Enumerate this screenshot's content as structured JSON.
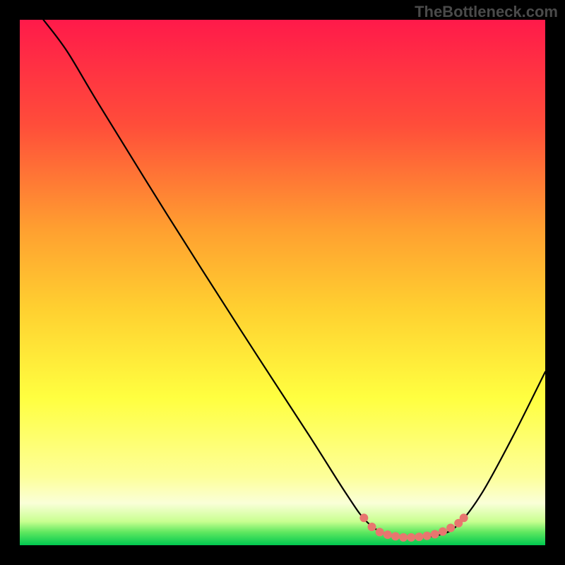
{
  "watermark": "TheBottleneck.com",
  "chart_data": {
    "type": "line",
    "title": "",
    "xlabel": "",
    "ylabel": "",
    "xlim": [
      0,
      100
    ],
    "ylim": [
      0,
      100
    ],
    "gradient_stops": [
      {
        "offset": 0,
        "color": "#ff1a4a"
      },
      {
        "offset": 20,
        "color": "#ff4d3a"
      },
      {
        "offset": 40,
        "color": "#ffa030"
      },
      {
        "offset": 55,
        "color": "#ffd030"
      },
      {
        "offset": 72,
        "color": "#ffff40"
      },
      {
        "offset": 87,
        "color": "#fdff9a"
      },
      {
        "offset": 92,
        "color": "#faffd8"
      },
      {
        "offset": 95.5,
        "color": "#c8ff90"
      },
      {
        "offset": 97.5,
        "color": "#60e860"
      },
      {
        "offset": 100,
        "color": "#00c850"
      }
    ],
    "curve_points": [
      {
        "x": 4.5,
        "y": 100
      },
      {
        "x": 9,
        "y": 94
      },
      {
        "x": 15,
        "y": 84
      },
      {
        "x": 28,
        "y": 63
      },
      {
        "x": 42,
        "y": 41
      },
      {
        "x": 55,
        "y": 21
      },
      {
        "x": 62,
        "y": 10
      },
      {
        "x": 66,
        "y": 4.5
      },
      {
        "x": 70,
        "y": 2
      },
      {
        "x": 75,
        "y": 1.5
      },
      {
        "x": 80,
        "y": 2
      },
      {
        "x": 83.5,
        "y": 4
      },
      {
        "x": 88,
        "y": 10
      },
      {
        "x": 94,
        "y": 21
      },
      {
        "x": 100,
        "y": 33
      }
    ],
    "highlight_dots": [
      {
        "x": 65.5,
        "y": 5.2
      },
      {
        "x": 67,
        "y": 3.5
      },
      {
        "x": 68.5,
        "y": 2.5
      },
      {
        "x": 70,
        "y": 2.0
      },
      {
        "x": 71.5,
        "y": 1.7
      },
      {
        "x": 73,
        "y": 1.5
      },
      {
        "x": 74.5,
        "y": 1.5
      },
      {
        "x": 76,
        "y": 1.6
      },
      {
        "x": 77.5,
        "y": 1.8
      },
      {
        "x": 79,
        "y": 2.1
      },
      {
        "x": 80.5,
        "y": 2.6
      },
      {
        "x": 82,
        "y": 3.3
      },
      {
        "x": 83.5,
        "y": 4.2
      },
      {
        "x": 84.5,
        "y": 5.2
      }
    ],
    "highlight_color": "#e8766f",
    "highlight_radius": 6,
    "curve_color": "#000000",
    "curve_width": 2.2
  }
}
